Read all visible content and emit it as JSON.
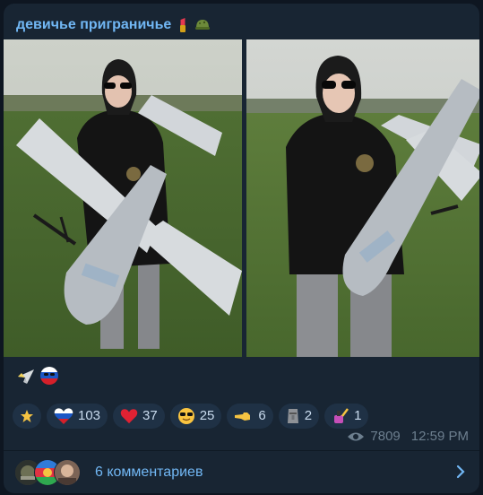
{
  "channel": {
    "name": "девичье приграничье"
  },
  "reactions": [
    {
      "icon": "star-icon",
      "count": ""
    },
    {
      "icon": "russia-heart-icon",
      "count": "103"
    },
    {
      "icon": "red-heart-icon",
      "count": "37"
    },
    {
      "icon": "sunglasses-smile-icon",
      "count": "25"
    },
    {
      "icon": "pointing-hand-icon",
      "count": "6"
    },
    {
      "icon": "moai-icon",
      "count": "2"
    },
    {
      "icon": "nail-polish-icon",
      "count": "1"
    }
  ],
  "meta": {
    "views": "7809",
    "time": "12:59 PM"
  },
  "comments": {
    "label": "6 комментариев"
  },
  "colors": {
    "accent": "#71b7f4",
    "bubble": "#182533",
    "chip": "#1f3145"
  }
}
